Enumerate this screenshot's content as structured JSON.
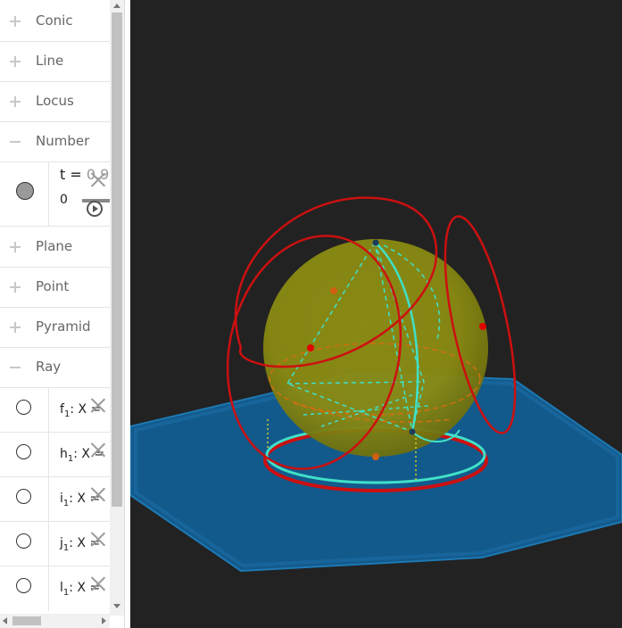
{
  "algebra": {
    "groups": [
      {
        "label": "Conic",
        "state": "collapsed"
      },
      {
        "label": "Line",
        "state": "collapsed"
      },
      {
        "label": "Locus",
        "state": "collapsed"
      },
      {
        "label": "Number",
        "state": "expanded"
      },
      {
        "label": "Plane",
        "state": "collapsed"
      },
      {
        "label": "Point",
        "state": "collapsed"
      },
      {
        "label": "Pyramid",
        "state": "collapsed"
      },
      {
        "label": "Ray",
        "state": "expanded"
      }
    ],
    "number_item": {
      "name": "t",
      "eq": " = ",
      "value": "0.9",
      "slider_min": "0"
    },
    "ray_items": [
      {
        "name": "f",
        "sub": "1",
        "rest": ": X = "
      },
      {
        "name": "h",
        "sub": "1",
        "rest": ": X = "
      },
      {
        "name": "i",
        "sub": "1",
        "rest": ": X = "
      },
      {
        "name": "j",
        "sub": "1",
        "rest": ": X = "
      },
      {
        "name": "l",
        "sub": "1",
        "rest": ": X = "
      }
    ]
  },
  "colors": {
    "background_3d": "#222222",
    "plane": "#1a6aa0",
    "sphere": "#9a9c1a",
    "red_curves": "#cc1010",
    "cyan_curves": "#40e0c8"
  }
}
